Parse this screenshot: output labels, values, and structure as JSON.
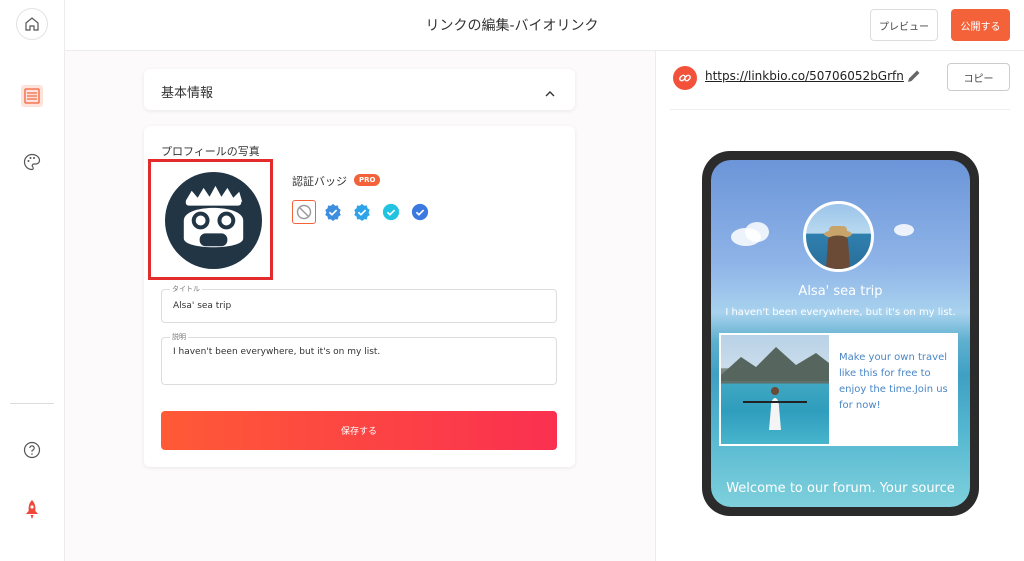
{
  "header": {
    "title": "リンクの編集-バイオリンク",
    "preview_label": "プレビュー",
    "publish_label": "公開する",
    "accent_color": "#f4623a"
  },
  "sidebar": {
    "icons": [
      "home-icon",
      "page-icon",
      "palette-icon",
      "help-icon",
      "rocket-icon"
    ]
  },
  "basic_info": {
    "label": "基本情報"
  },
  "profile": {
    "photo_label": "プロフィールの写真",
    "badge_label": "認証バッジ",
    "pro_label": "PRO",
    "badges": [
      "no-badge-icon",
      "verified-blue-icon",
      "verified-blue-icon",
      "verified-cyan-icon",
      "verified-blue-icon"
    ]
  },
  "form": {
    "title_label": "タイトル",
    "title_value": "Alsa' sea trip",
    "desc_label": "説明",
    "desc_value": "I haven't been everywhere, but it's on my list.",
    "save_label": "保存する"
  },
  "preview": {
    "url": "https://linkbio.co/50706052bGrfn",
    "copy_label": "コピー",
    "name": "Alsa' sea trip",
    "description": "I haven't been everywhere, but it's on my list.",
    "promo_text": "Make your own travel like this for free to enjoy the time.Join us for now!",
    "welcome": "Welcome to our forum. Your source"
  }
}
